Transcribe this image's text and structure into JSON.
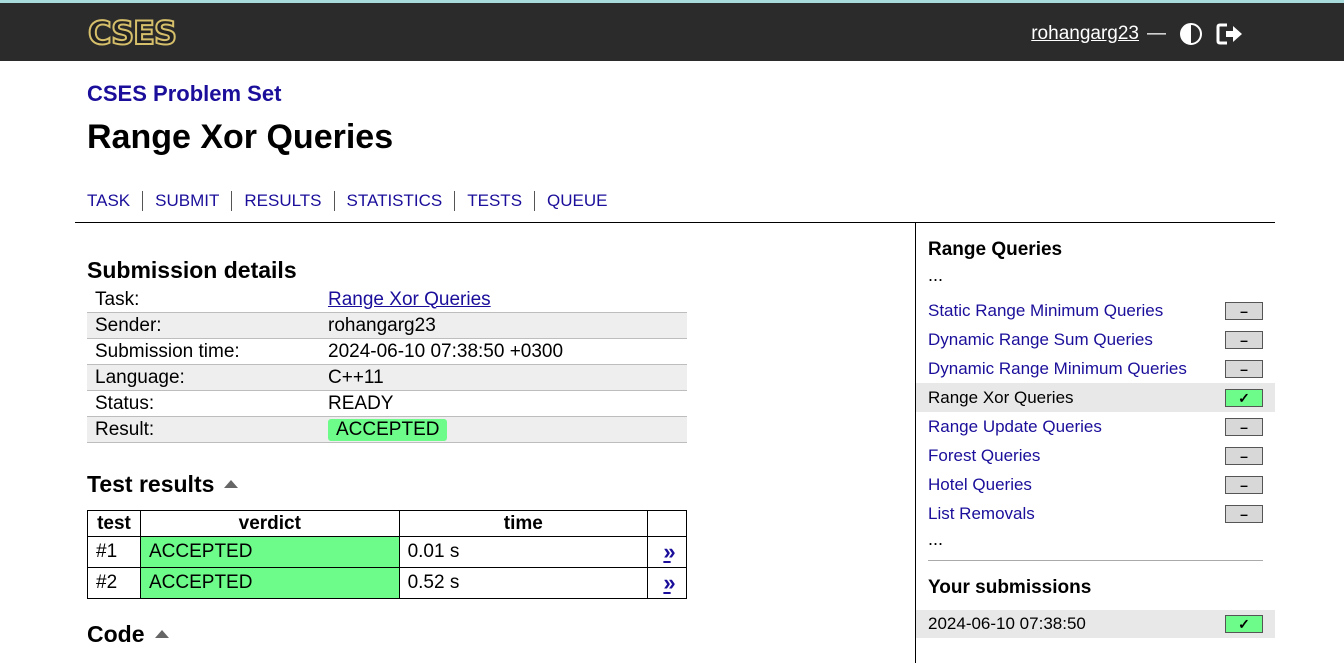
{
  "header": {
    "logo_text": "CSES",
    "username": "rohangarg23",
    "separator": "—"
  },
  "page": {
    "set_title": "CSES Problem Set",
    "title": "Range Xor Queries"
  },
  "nav": [
    "TASK",
    "SUBMIT",
    "RESULTS",
    "STATISTICS",
    "TESTS",
    "QUEUE"
  ],
  "submission": {
    "heading": "Submission details",
    "rows": [
      {
        "key": "Task:",
        "value": "Range Xor Queries"
      },
      {
        "key": "Sender:",
        "value": "rohangarg23"
      },
      {
        "key": "Submission time:",
        "value": "2024-06-10 07:38:50 +0300"
      },
      {
        "key": "Language:",
        "value": "C++11"
      },
      {
        "key": "Status:",
        "value": "READY"
      },
      {
        "key": "Result:",
        "value": "ACCEPTED"
      }
    ]
  },
  "tests": {
    "heading": "Test results",
    "columns": [
      "test",
      "verdict",
      "time",
      ""
    ],
    "rows": [
      {
        "test": "#1",
        "verdict": "ACCEPTED",
        "time": "0.01 s",
        "link": "»"
      },
      {
        "test": "#2",
        "verdict": "ACCEPTED",
        "time": "0.52 s",
        "link": "»"
      }
    ]
  },
  "code": {
    "heading": "Code"
  },
  "sidebar": {
    "heading": "Range Queries",
    "dots": "...",
    "problems": [
      {
        "name": "Static Range Minimum Queries",
        "status": "–"
      },
      {
        "name": "Dynamic Range Sum Queries",
        "status": "–"
      },
      {
        "name": "Dynamic Range Minimum Queries",
        "status": "–"
      },
      {
        "name": "Range Xor Queries",
        "status": "✓"
      },
      {
        "name": "Range Update Queries",
        "status": "–"
      },
      {
        "name": "Forest Queries",
        "status": "–"
      },
      {
        "name": "Hotel Queries",
        "status": "–"
      },
      {
        "name": "List Removals",
        "status": "–"
      }
    ],
    "submissions_heading": "Your submissions",
    "submission_time": "2024-06-10 07:38:50",
    "submission_status": "✓"
  },
  "colors": {
    "header_bg": "#2b2b2b",
    "link": "#1a0e9a",
    "accepted": "#6dfb8a"
  }
}
